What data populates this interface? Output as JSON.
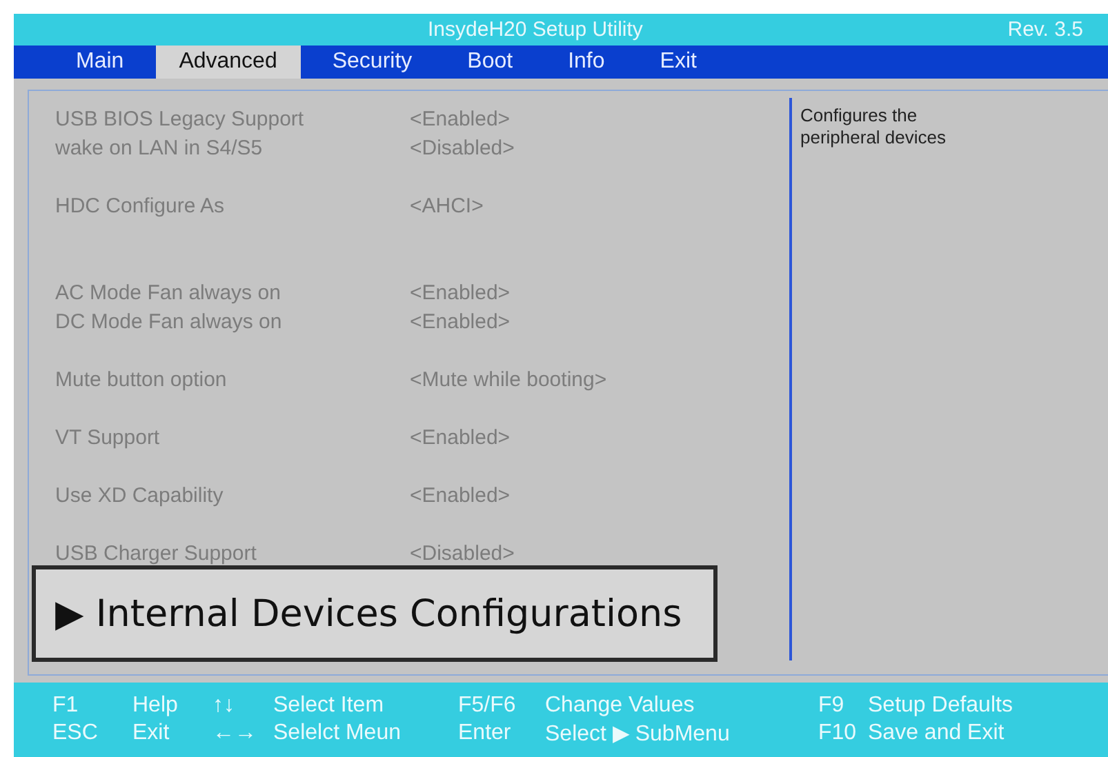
{
  "window": {
    "title": "InsydeH20 Setup Utility",
    "revision": "Rev. 3.5"
  },
  "tabs": [
    {
      "label": "Main",
      "selected": false
    },
    {
      "label": "Advanced",
      "selected": true
    },
    {
      "label": "Security",
      "selected": false
    },
    {
      "label": "Boot",
      "selected": false
    },
    {
      "label": "Info",
      "selected": false
    },
    {
      "label": "Exit",
      "selected": false
    }
  ],
  "settings": [
    [
      {
        "label": "USB BIOS Legacy Support",
        "value": "<Enabled>"
      },
      {
        "label": "wake on LAN in S4/S5",
        "value": "<Disabled>"
      }
    ],
    [
      {
        "label": "HDC Configure As",
        "value": "<AHCI>"
      }
    ],
    [
      {
        "label": "AC Mode Fan always on",
        "value": "<Enabled>"
      },
      {
        "label": "DC Mode Fan always on",
        "value": "<Enabled>"
      }
    ],
    [
      {
        "label": "Mute button option",
        "value": "<Mute while booting>"
      }
    ],
    [
      {
        "label": "VT Support",
        "value": "<Enabled>"
      }
    ],
    [
      {
        "label": "Use XD Capability",
        "value": "<Enabled>"
      }
    ],
    [
      {
        "label": "USB Charger Support",
        "value": "<Disabled>"
      }
    ]
  ],
  "submenu": "▶ Internal Devices Configurations",
  "help": "Configures the peripheral devices",
  "footer": [
    [
      {
        "key": "F1",
        "action": "Help"
      },
      {
        "key": "↑↓",
        "action": "Select Item"
      },
      {
        "key": "F5/F6",
        "action": "Change Values"
      },
      {
        "key": "F9",
        "action": "Setup Defaults"
      }
    ],
    [
      {
        "key": "ESC",
        "action": "Exit"
      },
      {
        "key": "←→",
        "action": "Selelct Meun"
      },
      {
        "key": "Enter",
        "action": "Select ▶ SubMenu"
      },
      {
        "key": "F10",
        "action": "Save and Exit"
      }
    ]
  ]
}
